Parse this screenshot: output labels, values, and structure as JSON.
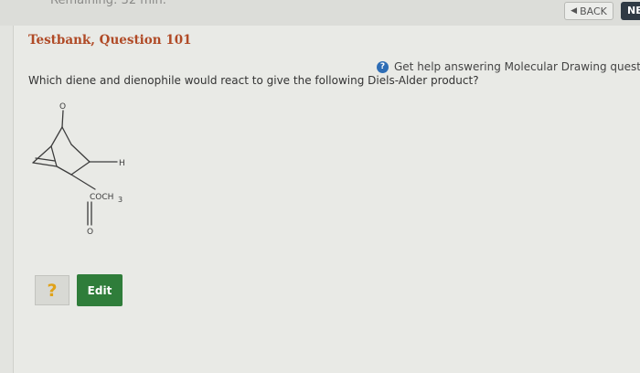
{
  "header": {
    "timer_text": "Remaining: 32 min.",
    "back_label": "BACK",
    "next_label": "NE"
  },
  "question": {
    "title": "Testbank, Question 101",
    "help_text": "Get help answering Molecular Drawing questi",
    "text": "Which diene and dienophile would react to give the following Diels-Alder product?"
  },
  "structure": {
    "bridge_label": "O",
    "h_label": "H",
    "substituent_label": "COCH",
    "subscript": "3",
    "carbonyl_o_label": "O"
  },
  "answer": {
    "status_symbol": "?",
    "edit_label": "Edit"
  }
}
